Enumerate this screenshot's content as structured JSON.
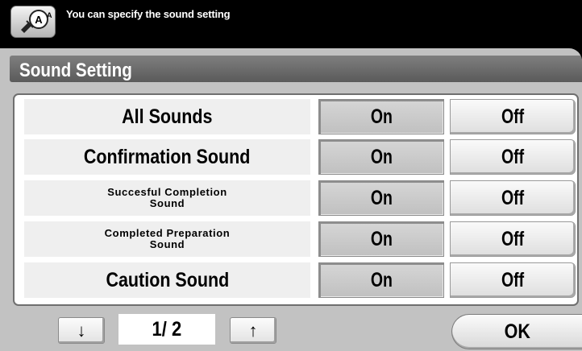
{
  "header": {
    "icon": "sound-setting-icon",
    "message": "You can specify the sound setting"
  },
  "screen": {
    "title": "Sound Setting"
  },
  "rows": [
    {
      "label": "All Sounds",
      "on": "On",
      "off": "Off",
      "selected": "On"
    },
    {
      "label": "Confirmation Sound",
      "on": "On",
      "off": "Off",
      "selected": "On"
    },
    {
      "label": "Succesful Completion\nSound",
      "on": "On",
      "off": "Off",
      "selected": "On"
    },
    {
      "label": "Completed Preparation\nSound",
      "on": "On",
      "off": "Off",
      "selected": "On"
    },
    {
      "label": "Caution Sound",
      "on": "On",
      "off": "Off",
      "selected": "On"
    }
  ],
  "footer": {
    "down_icon": "arrow-down-icon",
    "down": "↓",
    "page": "1/ 2",
    "up_icon": "arrow-up-icon",
    "up": "↑",
    "ok": "OK"
  }
}
